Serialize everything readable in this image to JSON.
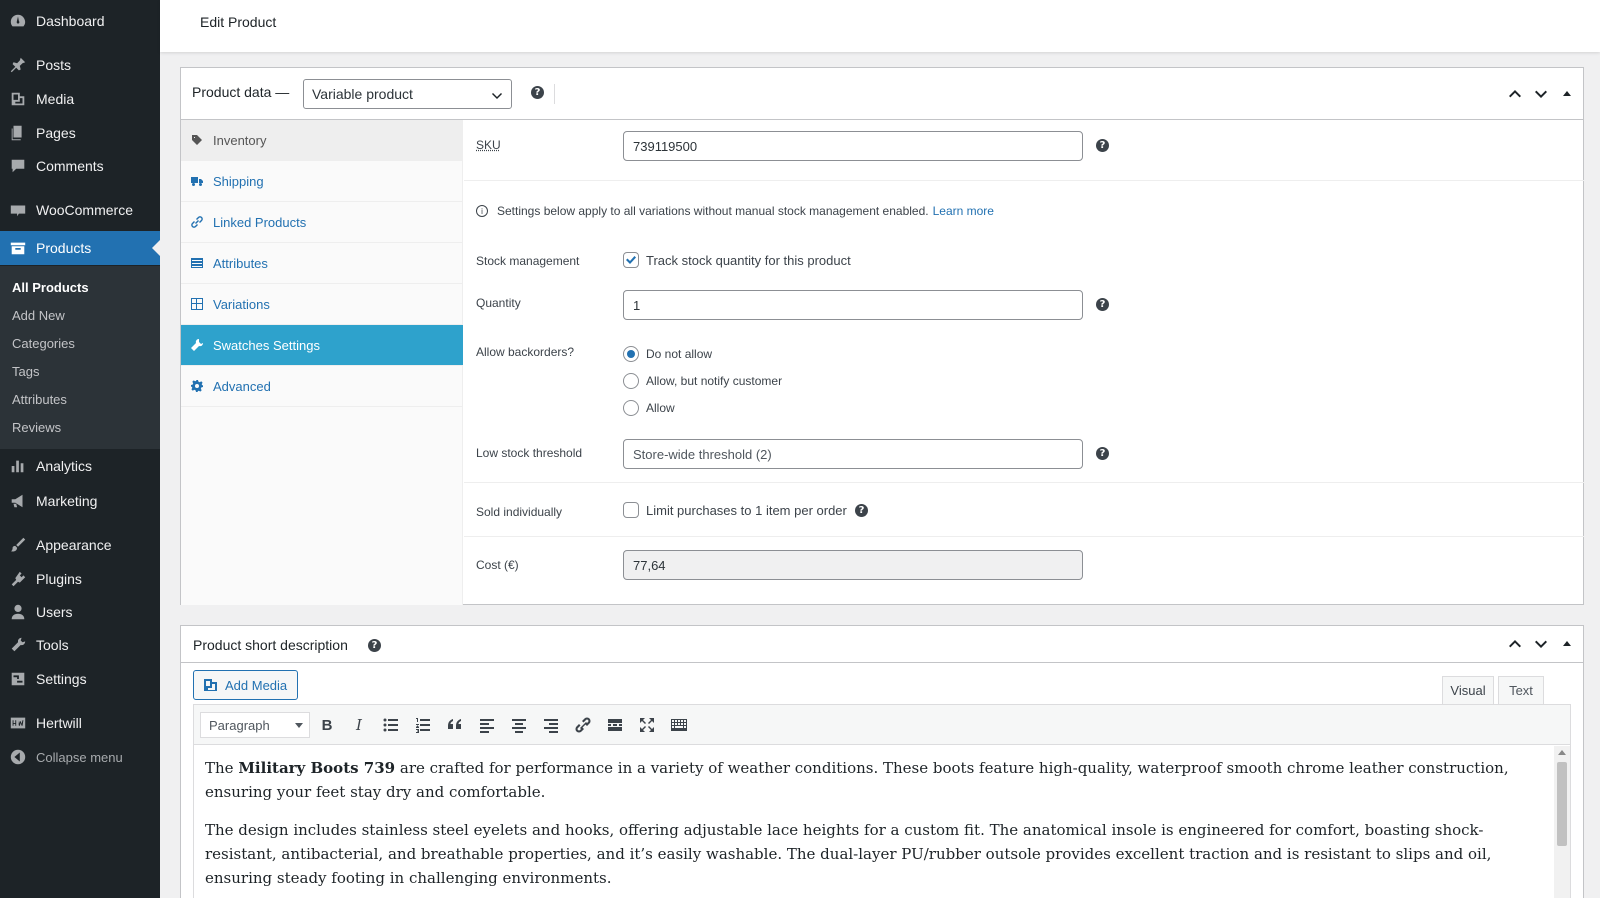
{
  "sidebar": {
    "items": [
      {
        "label": "Dashboard",
        "icon": "dashboard-icon"
      },
      {
        "label": "Posts",
        "icon": "pin-icon"
      },
      {
        "label": "Media",
        "icon": "media-icon"
      },
      {
        "label": "Pages",
        "icon": "pages-icon"
      },
      {
        "label": "Comments",
        "icon": "comments-icon"
      },
      {
        "label": "WooCommerce",
        "icon": "woo-icon"
      },
      {
        "label": "Products",
        "icon": "products-icon"
      },
      {
        "label": "Analytics",
        "icon": "analytics-icon"
      },
      {
        "label": "Marketing",
        "icon": "megaphone-icon"
      },
      {
        "label": "Appearance",
        "icon": "brush-icon"
      },
      {
        "label": "Plugins",
        "icon": "plugin-icon"
      },
      {
        "label": "Users",
        "icon": "users-icon"
      },
      {
        "label": "Tools",
        "icon": "wrench-icon"
      },
      {
        "label": "Settings",
        "icon": "settings-icon"
      },
      {
        "label": "Hertwill",
        "icon": "hw-icon"
      },
      {
        "label": "Collapse menu",
        "icon": "collapse-icon"
      }
    ],
    "submenu": [
      "All Products",
      "Add New",
      "Categories",
      "Tags",
      "Attributes",
      "Reviews"
    ]
  },
  "header": {
    "title": "Edit Product"
  },
  "product_data": {
    "label": "Product data —",
    "type": "Variable product",
    "tabs": [
      "Inventory",
      "Shipping",
      "Linked Products",
      "Attributes",
      "Variations",
      "Swatches Settings",
      "Advanced"
    ],
    "sku_label": "SKU",
    "sku_value": "739119500",
    "notice_text": "Settings below apply to all variations without manual stock management enabled.",
    "notice_link": "Learn more",
    "stock_management_label": "Stock management",
    "track_stock_label": "Track stock quantity for this product",
    "quantity_label": "Quantity",
    "quantity_value": "1",
    "backorders_label": "Allow backorders?",
    "backorder_options": [
      "Do not allow",
      "Allow, but notify customer",
      "Allow"
    ],
    "low_stock_label": "Low stock threshold",
    "low_stock_placeholder": "Store-wide threshold (2)",
    "sold_individually_label": "Sold individually",
    "limit_label": "Limit purchases to 1 item per order",
    "cost_label": "Cost (€)",
    "cost_value": "77,64"
  },
  "short_description": {
    "title": "Product short description",
    "add_media": "Add Media",
    "tab_visual": "Visual",
    "tab_text": "Text",
    "format": "Paragraph",
    "para1_pre": "The ",
    "para1_bold": "Military Boots 739",
    "para1_post": " are crafted for performance in a variety of weather conditions. These boots feature high-quality, waterproof smooth chrome leather construction, ensuring your feet stay dry and comfortable.",
    "para2": "The design includes stainless steel eyelets and hooks, offering adjustable lace heights for a custom fit. The anatomical insole is engineered for comfort, boasting shock-resistant, antibacterial, and breathable properties, and it’s easily washable. The dual-layer PU/rubber outsole provides excellent traction and is resistant to slips and oil, ensuring steady footing in challenging environments."
  },
  "colors": {
    "accent": "#2271b1",
    "active_tab": "#2ea2cc",
    "sidebar": "#1d2327"
  }
}
